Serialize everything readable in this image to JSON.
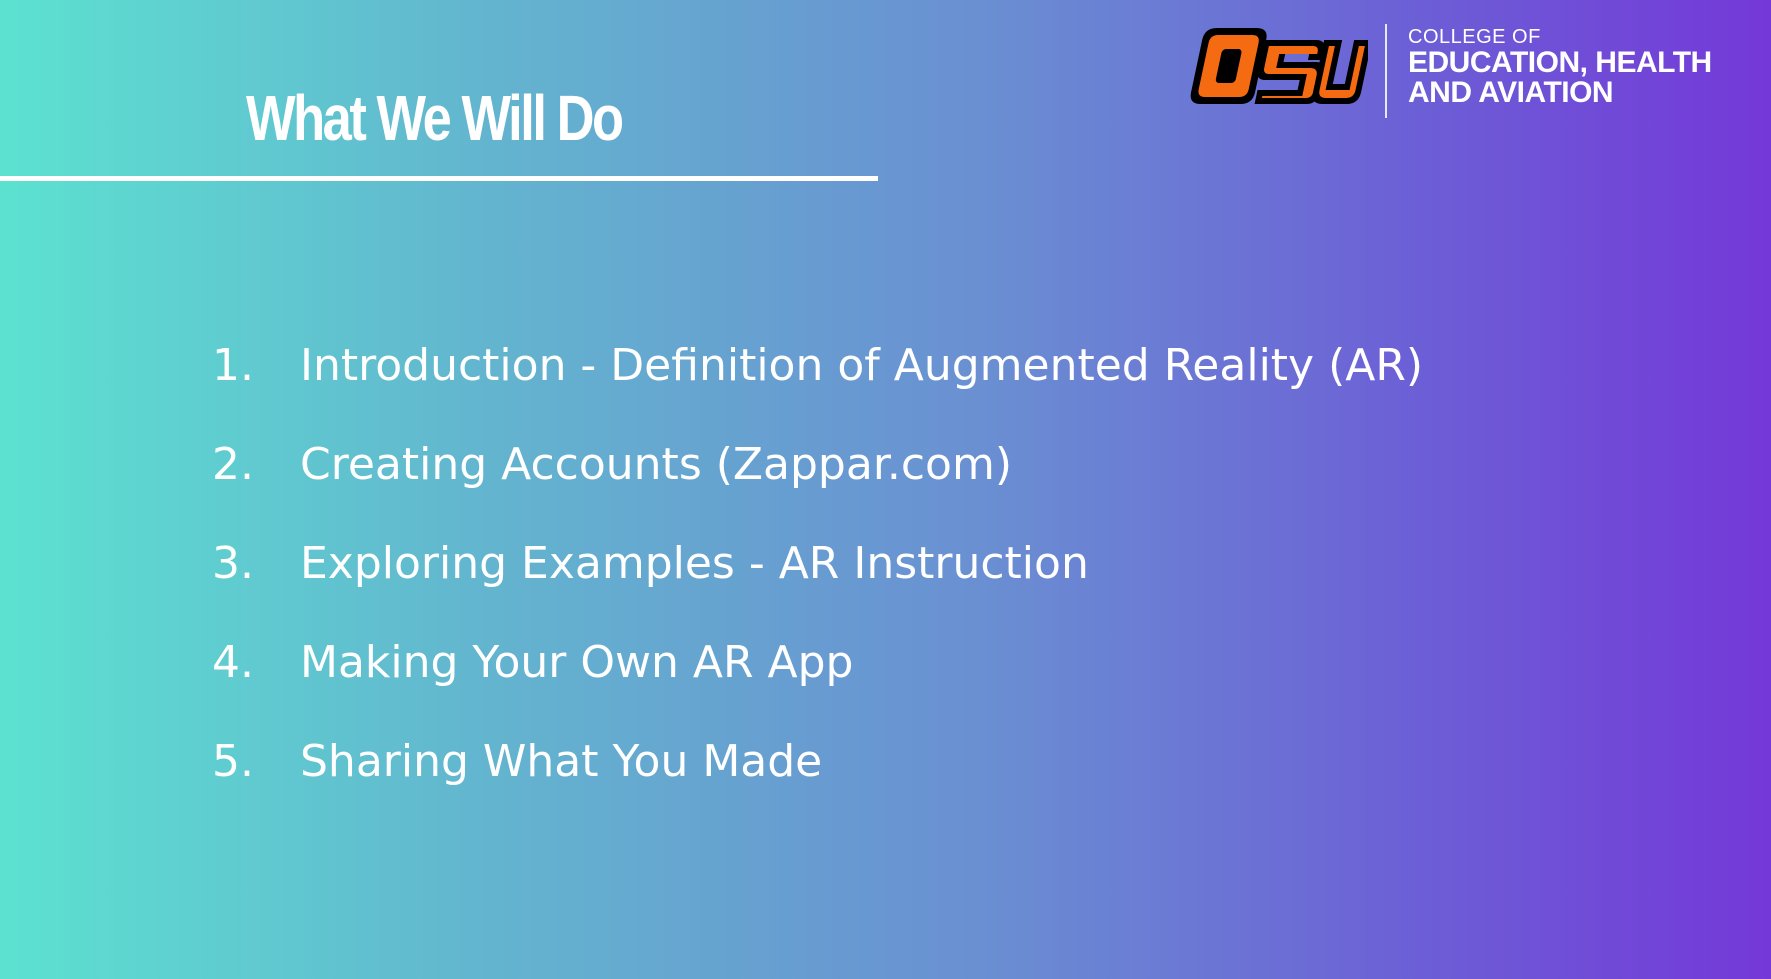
{
  "slide": {
    "title": "What We Will Do"
  },
  "branding": {
    "logo_text": "OSU",
    "college_line1": "COLLEGE OF",
    "college_line2": "EDUCATION, HEALTH",
    "college_line3": "AND AVIATION",
    "logo_colors": {
      "orange": "#f56b12",
      "black": "#000000"
    }
  },
  "agenda": [
    {
      "number": "1.",
      "text": "Introduction - Definition of Augmented Reality (AR)"
    },
    {
      "number": "2.",
      "text": "Creating Accounts (Zappar.com)"
    },
    {
      "number": "3.",
      "text": "Exploring Examples - AR Instruction"
    },
    {
      "number": "4.",
      "text": "Making Your Own AR App"
    },
    {
      "number": "5.",
      "text": "Sharing What You Made"
    }
  ],
  "colors": {
    "gradient_start": "#5ce1d0",
    "gradient_end": "#7438d8",
    "text": "#ffffff"
  }
}
